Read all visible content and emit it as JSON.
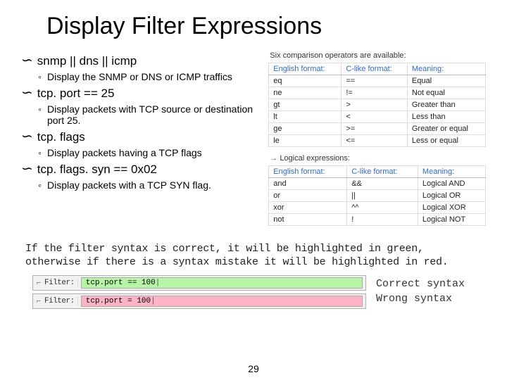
{
  "title": "Display Filter Expressions",
  "bullets": {
    "b1": {
      "text": "snmp || dns || icmp",
      "sub": "Display the SNMP or DNS or ICMP traffics"
    },
    "b2": {
      "text": "tcp. port == 25",
      "sub": "Display packets with TCP source or destination port 25."
    },
    "b3": {
      "text": "tcp. flags",
      "sub": "Display packets having a TCP flags"
    },
    "b4": {
      "text": "tcp. flags. syn == 0x02",
      "sub": "Display packets with a TCP SYN flag."
    }
  },
  "comp_caption": "Six comparison operators are available:",
  "log_caption": "Logical expressions:",
  "comp_table": {
    "headers": [
      "English format:",
      "C-like format:",
      "Meaning:"
    ],
    "rows": [
      [
        "eq",
        "==",
        "Equal"
      ],
      [
        "ne",
        "!=",
        "Not equal"
      ],
      [
        "gt",
        ">",
        "Greater than"
      ],
      [
        "lt",
        "<",
        "Less than"
      ],
      [
        "ge",
        ">=",
        "Greater or equal"
      ],
      [
        "le",
        "<=",
        "Less or equal"
      ]
    ]
  },
  "log_table": {
    "headers": [
      "English format:",
      "C-like format:",
      "Meaning:"
    ],
    "rows": [
      [
        "and",
        "&&",
        "Logical AND"
      ],
      [
        "or",
        "||",
        "Logical OR"
      ],
      [
        "xor",
        "^^",
        "Logical XOR"
      ],
      [
        "not",
        "!",
        "Logical NOT"
      ]
    ]
  },
  "footnote": "If the filter syntax is correct, it will be highlighted in green, otherwise if there is a syntax mistake it will be highlighted in red.",
  "filterbar": {
    "label": "Filter:",
    "ok_value": "tcp.port == 100",
    "bad_value": "tcp.port = 100"
  },
  "legend": {
    "ok": "Correct syntax",
    "bad": "Wrong syntax"
  },
  "page": "29"
}
